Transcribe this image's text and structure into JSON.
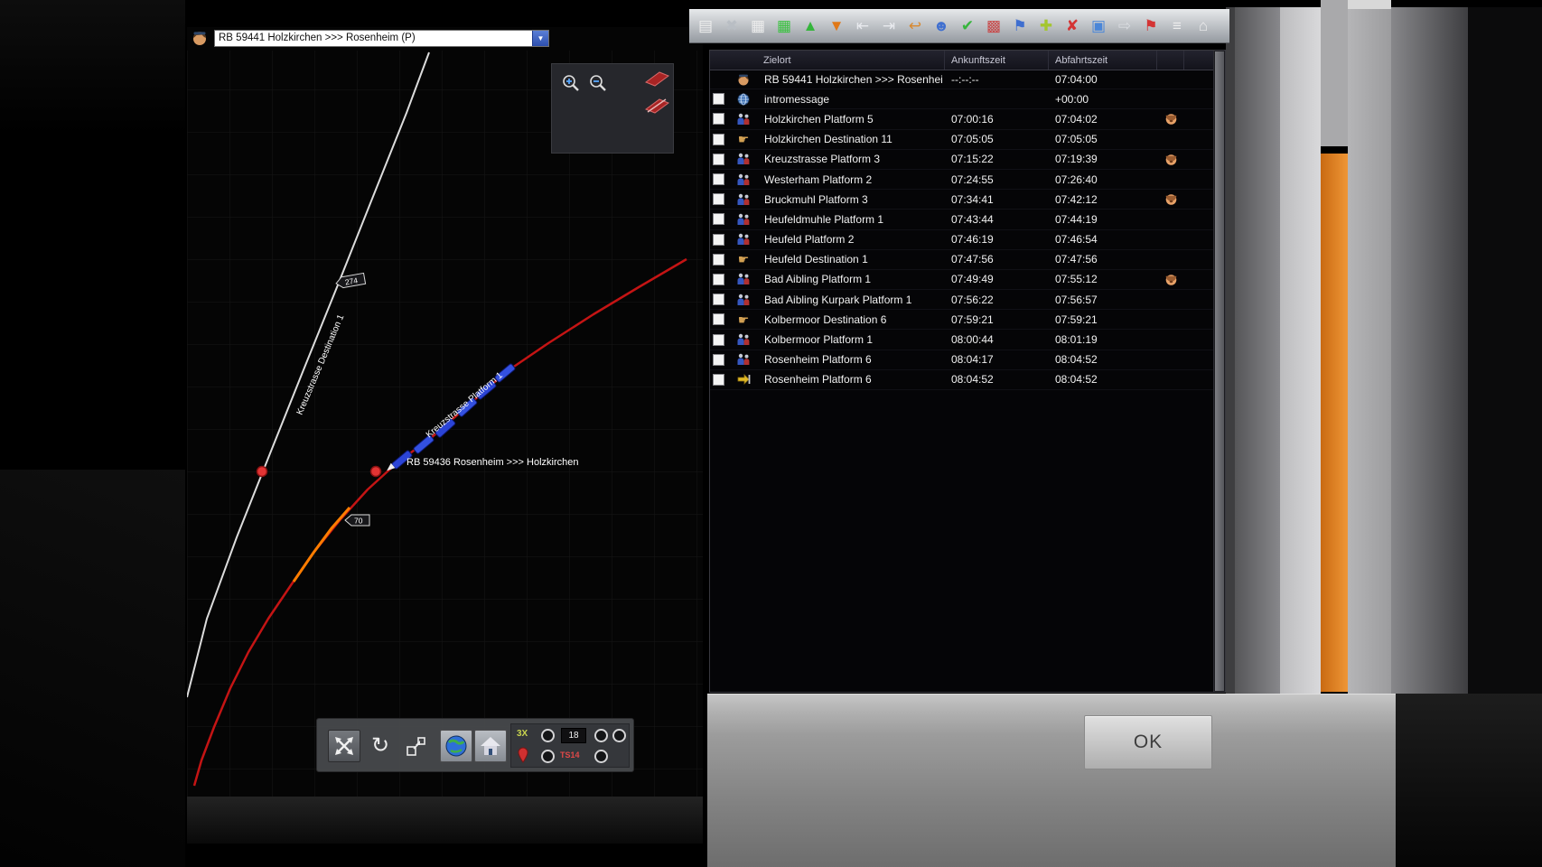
{
  "route_selector": {
    "value": "RB 59441 Holzkirchen >>> Rosenheim (P)"
  },
  "icons": {
    "dropdown_arrow": "▼",
    "rotate_tool": "↻"
  },
  "toolbar": {
    "buttons": [
      {
        "name": "save",
        "glyph": "▤",
        "color": "#efefef"
      },
      {
        "name": "delete",
        "glyph": "✖",
        "color": "#b9bec4"
      },
      {
        "name": "grid",
        "glyph": "▦",
        "color": "#ededed"
      },
      {
        "name": "grid-active",
        "glyph": "▦",
        "color": "#39c23f"
      },
      {
        "name": "move-up",
        "glyph": "▲",
        "color": "#35b53c"
      },
      {
        "name": "move-down",
        "glyph": "▼",
        "color": "#e07818"
      },
      {
        "name": "insert-before",
        "glyph": "⇤",
        "color": "#e8eaee"
      },
      {
        "name": "insert-after",
        "glyph": "⇥",
        "color": "#e8eaee"
      },
      {
        "name": "undo",
        "glyph": "↩",
        "color": "#d8882e"
      },
      {
        "name": "passenger",
        "glyph": "☻",
        "color": "#3f6fd0"
      },
      {
        "name": "confirm-edit",
        "glyph": "✔",
        "color": "#36b53c"
      },
      {
        "name": "grid-colors",
        "glyph": "▩",
        "color": "#c84848"
      },
      {
        "name": "route-flag",
        "glyph": "⚑",
        "color": "#3f6fd0"
      },
      {
        "name": "add-stop",
        "glyph": "✚",
        "color": "#a4c62f"
      },
      {
        "name": "remove-stop",
        "glyph": "✘",
        "color": "#d43434"
      },
      {
        "name": "window-options",
        "glyph": "▣",
        "color": "#4a86d8"
      },
      {
        "name": "exit",
        "glyph": "⇨",
        "color": "#dadce0"
      },
      {
        "name": "flag",
        "glyph": "⚑",
        "color": "#d43434"
      },
      {
        "name": "platform-strip",
        "glyph": "≡",
        "color": "#ececec"
      },
      {
        "name": "depot",
        "glyph": "⌂",
        "color": "#ececec"
      }
    ]
  },
  "timetable": {
    "columns": {
      "destination": "Zielort",
      "arrival": "Ankunftszeit",
      "departure": "Abfahrtszeit"
    },
    "rows": [
      {
        "checkbox": false,
        "icon": "driver",
        "label": "RB 59441 Holzkirchen >>> Rosenhei",
        "arrival": "--:--:--",
        "departure": "07:04:00",
        "announce": false
      },
      {
        "checkbox": true,
        "icon": "message",
        "label": "intromessage",
        "arrival": "",
        "departure": "+00:00",
        "announce": false
      },
      {
        "checkbox": true,
        "icon": "platform",
        "label": "Holzkirchen Platform 5",
        "arrival": "07:00:16",
        "departure": "07:04:02",
        "announce": true
      },
      {
        "checkbox": true,
        "icon": "destination",
        "label": "Holzkirchen Destination 11",
        "arrival": "07:05:05",
        "departure": "07:05:05",
        "announce": false
      },
      {
        "checkbox": true,
        "icon": "platform",
        "label": "Kreuzstrasse Platform 3",
        "arrival": "07:15:22",
        "departure": "07:19:39",
        "announce": true
      },
      {
        "checkbox": true,
        "icon": "platform",
        "label": "Westerham Platform 2",
        "arrival": "07:24:55",
        "departure": "07:26:40",
        "announce": false
      },
      {
        "checkbox": true,
        "icon": "platform",
        "label": "Bruckmuhl Platform 3",
        "arrival": "07:34:41",
        "departure": "07:42:12",
        "announce": true
      },
      {
        "checkbox": true,
        "icon": "platform",
        "label": "Heufeldmuhle Platform 1",
        "arrival": "07:43:44",
        "departure": "07:44:19",
        "announce": false
      },
      {
        "checkbox": true,
        "icon": "platform",
        "label": "Heufeld Platform 2",
        "arrival": "07:46:19",
        "departure": "07:46:54",
        "announce": false
      },
      {
        "checkbox": true,
        "icon": "destination",
        "label": "Heufeld Destination 1",
        "arrival": "07:47:56",
        "departure": "07:47:56",
        "announce": false
      },
      {
        "checkbox": true,
        "icon": "platform",
        "label": "Bad Aibling Platform 1",
        "arrival": "07:49:49",
        "departure": "07:55:12",
        "announce": true
      },
      {
        "checkbox": true,
        "icon": "platform",
        "label": "Bad Aibling Kurpark Platform 1",
        "arrival": "07:56:22",
        "departure": "07:56:57",
        "announce": false
      },
      {
        "checkbox": true,
        "icon": "destination",
        "label": "Kolbermoor Destination 6",
        "arrival": "07:59:21",
        "departure": "07:59:21",
        "announce": false
      },
      {
        "checkbox": true,
        "icon": "platform",
        "label": "Kolbermoor Platform 1",
        "arrival": "08:00:44",
        "departure": "08:01:19",
        "announce": false
      },
      {
        "checkbox": true,
        "icon": "platform",
        "label": "Rosenheim Platform 6",
        "arrival": "08:04:17",
        "departure": "08:04:52",
        "announce": false
      },
      {
        "checkbox": true,
        "icon": "train-end",
        "label": "Rosenheim Platform 6",
        "arrival": "08:04:52",
        "departure": "08:04:52",
        "announce": false
      }
    ]
  },
  "map": {
    "train_label": "RB 59436 Rosenheim >>> Holzkirchen",
    "station_label_top": "Kreuzstrasse Destination 1",
    "station_label_train": "Kreuzstrasse Platform 1",
    "signal_274": "274",
    "signal_70": "70",
    "controls": {
      "tool_label": "3X",
      "value": "18",
      "ts_label": "TS14"
    },
    "colors": {
      "track_main": "#c41414",
      "track_side": "#dcdcdc",
      "occupied": "#ff7d00",
      "train": "#2b44d6"
    }
  },
  "dialog": {
    "ok_label": "OK"
  }
}
